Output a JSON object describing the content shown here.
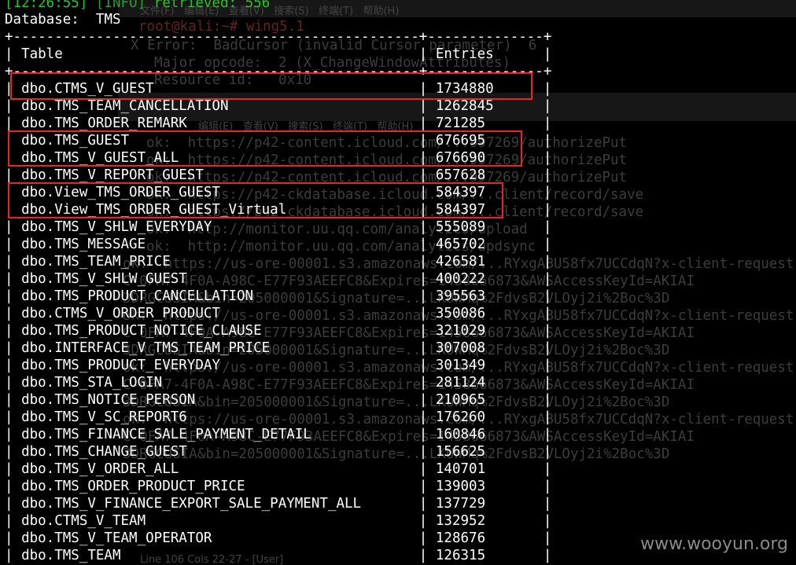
{
  "status_line": {
    "time": "[12:26:55]",
    "level": "[INFO]",
    "message": "retrieved: 556"
  },
  "database": {
    "label": "Database:",
    "name": "TMS"
  },
  "table": {
    "border": "+-------------------------------------------------+--------------+",
    "header_table": "Table",
    "header_entries": "Entries",
    "rows": [
      {
        "name": "dbo.CTMS_V_GUEST",
        "entries": "1734880"
      },
      {
        "name": "dbo.TMS_TEAM_CANCELLATION",
        "entries": "1262845"
      },
      {
        "name": "dbo.TMS_ORDER_REMARK",
        "entries": "721285"
      },
      {
        "name": "dbo.TMS_GUEST",
        "entries": "676695"
      },
      {
        "name": "dbo.TMS_V_GUEST_ALL",
        "entries": "676690"
      },
      {
        "name": "dbo.TMS_V_REPORT_GUEST",
        "entries": "657628"
      },
      {
        "name": "dbo.View_TMS_ORDER_GUEST",
        "entries": "584397"
      },
      {
        "name": "dbo.View_TMS_ORDER_GUEST_Virtual",
        "entries": "584397"
      },
      {
        "name": "dbo.TMS_V_SHLW_EVERYDAY",
        "entries": "555089"
      },
      {
        "name": "dbo.TMS_MESSAGE",
        "entries": "465702"
      },
      {
        "name": "dbo.TMS_TEAM_PRICE",
        "entries": "426581"
      },
      {
        "name": "dbo.TMS_V_SHLW_GUEST",
        "entries": "400222"
      },
      {
        "name": "dbo.TMS_PRODUCT_CANCELLATION",
        "entries": "395563"
      },
      {
        "name": "dbo.CTMS_V_ORDER_PRODUCT",
        "entries": "350086"
      },
      {
        "name": "dbo.TMS_PRODUCT_NOTICE_CLAUSE",
        "entries": "321029"
      },
      {
        "name": "dbo.INTERFACE_V_TMS_TEAM_PRICE",
        "entries": "307008"
      },
      {
        "name": "dbo.TMS_PRODUCT_EVERYDAY",
        "entries": "301349"
      },
      {
        "name": "dbo.TMS_STA_LOGIN",
        "entries": "281124"
      },
      {
        "name": "dbo.TMS_NOTICE_PERSON",
        "entries": "210965"
      },
      {
        "name": "dbo.TMS_V_SC_REPORT6",
        "entries": "176260"
      },
      {
        "name": "dbo.TMS_FINANCE_SALE_PAYMENT_DETAIL",
        "entries": "160846"
      },
      {
        "name": "dbo.TMS_CHANGE_GUEST",
        "entries": "156625"
      },
      {
        "name": "dbo.TMS_V_ORDER_ALL",
        "entries": "140701"
      },
      {
        "name": "dbo.TMS_ORDER_PRODUCT_PRICE",
        "entries": "139003"
      },
      {
        "name": "dbo.TMS_V_FINANCE_EXPORT_SALE_PAYMENT_ALL",
        "entries": "137729"
      },
      {
        "name": "dbo.CTMS_V_TEAM",
        "entries": "132952"
      },
      {
        "name": "dbo.TMS_V_TEAM_OPERATOR",
        "entries": "128676"
      },
      {
        "name": "dbo.TMS_TEAM",
        "entries": "126315"
      }
    ]
  },
  "background": {
    "menu_top": "文件(F)   编辑(E)   查看(V)   搜索(S)   终端(T)   帮助(H)",
    "menu_mid": "编辑(E)   查看(V)   搜索(S)   终端(T)   帮助(H)",
    "prompt": "root@kali:~# wing5.1",
    "x_error": "X Error:  BadCursor (invalid Cursor parameter)  6",
    "opcode": "Major opcode:  2 (X_ChangeWindowAttributes)",
    "resource": "Resource id:   0x10",
    "bottom_status": "Line 106 Cols 22-27 - [User]",
    "lines": [
      "ok:  https://p42-content.icloud.com/...997269/authorizePut",
      "ok:  https://p42-content.icloud.com/...997269/authorizePut",
      "ok:  https://p42-content.icloud.com/...997269/authorizePut",
      "ok:  https://p42-ckdatabase.icloud.com/...client/record/save",
      "ok:  https://p42-ckdatabase.icloud.com/...client/record/save",
      "ok:  http://monitor.uu.qq.com/analytics/upload",
      "ok:  http://monitor.uu.qq.com/analytics/updsync",
      "ok:  https://us-ore-00001.s3.amazonaws.com/...RYxgABU58fx7UCCdqN?x-client-request",
      "C-0FA7-4F0A-A98C-E77F93AEEFC8&Expires=1458666873&AWSAccessKeyId=AKIAI",
      "3DRGCUSIA&bin=205000001&Signature=...LKUWMq%2FdvsB2VLOyj2i%2Boc%3D",
      "ok:  https://us-ore-00001.s3.amazonaws.com/...RYxgABU58fx7UCCdqN?x-client-request",
      "C-0FA7-4F0A-A98C-E77F93AEEFC8&Expires=1458666873&AWSAccessKeyId=AKIAI",
      "3DRGCUSIA&bin=205000001&Signature=...LKUWMq%2FdvsB2VLOyj2i%2Boc%3D",
      "ok:  https://us-ore-00001.s3.amazonaws.com/...RYxgABU58fx7UCCdqN?x-client-request",
      "C-0FA7-4F0A-A98C-E77F93AEEFC8&Expires=1458666873&AWSAccessKeyId=AKIAI",
      "3DRGCUSIA&bin=205000001&Signature=...LKUWMq%2FdvsB2VLOyj2i%2Boc%3D",
      "ok:  https://us-ore-00001.s3.amazonaws.com/...RYxgABU58fx7UCCdqN?x-client-request",
      "C-0FA7-4F0A-A98C-E77F93AEEFC8&Expires=1458666873&AWSAccessKeyId=AKIAI",
      "3DRGCUSIA&bin=205000001&Signature=...LKUWMq%2FdvsB2VLOyj2i%2Boc%3D"
    ]
  },
  "watermark": "www.wooyun.org",
  "colors": {
    "highlight_box": "#e5262b",
    "status_green": "#27c627",
    "text": "#ffffff"
  }
}
